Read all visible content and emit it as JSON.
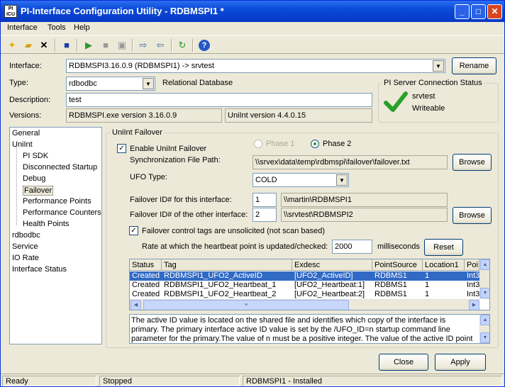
{
  "window": {
    "title": "PI-Interface Configuration Utility - RDBMSPI1 *",
    "app_icon_text": "PI ICU",
    "minimize": "_",
    "maximize": "□",
    "close": "✕"
  },
  "menu": [
    "Interface",
    "Tools",
    "Help"
  ],
  "toolbar_icons": [
    "new-icon",
    "open-icon",
    "delete-icon",
    "save-icon",
    "start-icon",
    "stop-icon",
    "service-icon",
    "export-icon",
    "import-icon",
    "refresh-icon",
    "help-icon"
  ],
  "form": {
    "interface_label": "Interface:",
    "interface_value": "RDBMSPI3.16.0.9 (RDBMSPI1) -> srvtest",
    "rename_button": "Rename",
    "type_label": "Type:",
    "type_value": "rdbodbc",
    "type_desc": "Relational Database",
    "description_label": "Description:",
    "description_value": "test",
    "versions_label": "Versions:",
    "exe_version": "RDBMSPI.exe version 3.16.0.9",
    "uniint_version": "UniInt version 4.4.0.15"
  },
  "server_status": {
    "legend": "PI Server Connection Status",
    "server": "srvtest",
    "state": "Writeable",
    "color": "#2aa02a"
  },
  "tree": {
    "items": [
      {
        "label": "General",
        "indent": 0
      },
      {
        "label": "UniInt",
        "indent": 0
      },
      {
        "label": "PI SDK",
        "indent": 1
      },
      {
        "label": "Disconnected Startup",
        "indent": 1
      },
      {
        "label": "Debug",
        "indent": 1
      },
      {
        "label": "Failover",
        "indent": 1,
        "selected": true
      },
      {
        "label": "Performance Points",
        "indent": 1
      },
      {
        "label": "Performance Counters",
        "indent": 1
      },
      {
        "label": "Health Points",
        "indent": 1
      },
      {
        "label": "rdbodbc",
        "indent": 0
      },
      {
        "label": "Service",
        "indent": 0
      },
      {
        "label": "IO Rate",
        "indent": 0
      },
      {
        "label": "Interface Status",
        "indent": 0
      }
    ]
  },
  "failover": {
    "legend": "UniInt Failover",
    "enable_label": "Enable UniInt Failover",
    "enable_checked": true,
    "phase1": "Phase 1",
    "phase2": "Phase 2",
    "sync_path_label": "Synchronization File Path:",
    "sync_path_value": "\\\\srvex\\data\\temp\\rdbmspi\\failover\\failover.txt",
    "browse": "Browse",
    "ufo_type_label": "UFO Type:",
    "ufo_type_value": "COLD",
    "id_this_label": "Failover ID# for this interface:",
    "id_this_value": "1",
    "id_this_host": "\\\\martin\\RDBMSPI1",
    "id_other_label": "Failover ID# of the other interface:",
    "id_other_value": "2",
    "id_other_host": "\\\\srvtest\\RDBMSPI2",
    "unsolicited_label": "Failover control tags are unsolicited (not scan based)",
    "unsolicited_checked": true,
    "heartbeat_label": "Rate at which the heartbeat point is updated/checked:",
    "heartbeat_value": "2000",
    "heartbeat_unit": "milliseconds",
    "reset": "Reset"
  },
  "table": {
    "headers": [
      "Status",
      "Tag",
      "Exdesc",
      "PointSource",
      "Location1",
      "Poi"
    ],
    "rows": [
      [
        "Created",
        "RDBMSPI1_UFO2_ActiveID",
        "[UFO2_ActiveID]",
        "RDBMS1",
        "1",
        "Int3"
      ],
      [
        "Created",
        "RDBMSPI1_UFO2_Heartbeat_1",
        "[UFO2_Heartbeat:1]",
        "RDBMS1",
        "1",
        "Int3"
      ],
      [
        "Created",
        "RDBMSPI1_UFO2_Heartbeat_2",
        "[UFO2_Heartbeat:2]",
        "RDBMS1",
        "1",
        "Int3"
      ]
    ]
  },
  "description_text": "The active ID value is located on the shared file and identifies which copy of the interface is primary. The primary interface active ID value is set by the /UFO_ID=n startup command line parameter for the primary.The value of n must be a positive integer. The value of the active ID point is referred to as the",
  "buttons": {
    "close": "Close",
    "apply": "Apply"
  },
  "status_bar": [
    "Ready",
    "Stopped",
    "RDBMSPI1 - Installed"
  ]
}
